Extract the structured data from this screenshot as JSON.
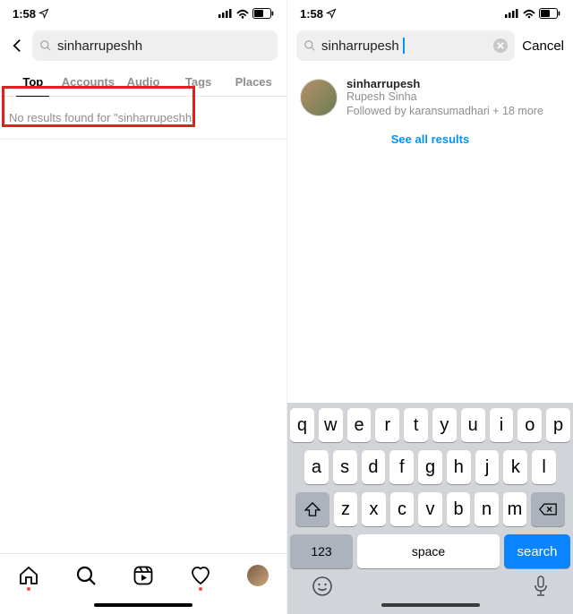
{
  "status": {
    "time": "1:58",
    "loc_icon": "➤",
    "cell": "⁙",
    "wifi": "wifi",
    "battery": "batt"
  },
  "left": {
    "search_value": "sinharrupeshh",
    "tabs": [
      "Top",
      "Accounts",
      "Audio",
      "Tags",
      "Places"
    ],
    "active_tab": 0,
    "no_results_text": "No results found for \"sinharrupeshh\""
  },
  "right": {
    "search_value": "sinharrupesh",
    "cancel_label": "Cancel",
    "result": {
      "username": "sinharrupesh",
      "fullname": "Rupesh Sinha",
      "meta": "Followed by karansumadhari + 18 more"
    },
    "see_all_label": "See all results"
  },
  "keyboard": {
    "row1": [
      "q",
      "w",
      "e",
      "r",
      "t",
      "y",
      "u",
      "i",
      "o",
      "p"
    ],
    "row2": [
      "a",
      "s",
      "d",
      "f",
      "g",
      "h",
      "j",
      "k",
      "l"
    ],
    "row3": [
      "z",
      "x",
      "c",
      "v",
      "b",
      "n",
      "m"
    ],
    "num_label": "123",
    "space_label": "space",
    "search_label": "search"
  }
}
